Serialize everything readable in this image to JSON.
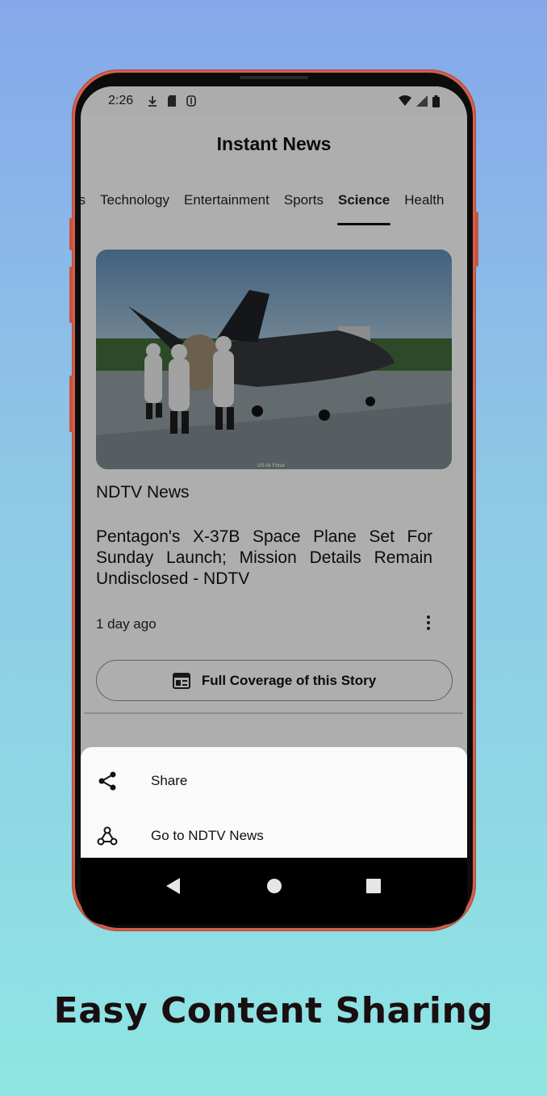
{
  "status_bar": {
    "time": "2:26"
  },
  "app": {
    "title": "Instant News"
  },
  "tabs": [
    {
      "label": "ss",
      "active": false
    },
    {
      "label": "Technology",
      "active": false
    },
    {
      "label": "Entertainment",
      "active": false
    },
    {
      "label": "Sports",
      "active": false
    },
    {
      "label": "Science",
      "active": true
    },
    {
      "label": "Health",
      "active": false
    }
  ],
  "article": {
    "image_credit": "US Air Force",
    "source": "NDTV News",
    "headline": "Pentagon's X-37B Space Plane Set For Sunday Launch; Mission Details Remain Undisclosed - NDTV",
    "time_ago": "1 day ago",
    "coverage_label": "Full Coverage of this Story"
  },
  "sheet": {
    "items": [
      {
        "label": "Share",
        "icon": "share-icon"
      },
      {
        "label": "Go to NDTV News",
        "icon": "webhook-icon"
      }
    ]
  },
  "caption": "Easy Content Sharing",
  "colors": {
    "frame": "#d35f4a",
    "bg_top": "#85a8ea",
    "bg_bottom": "#8ee6e3"
  }
}
